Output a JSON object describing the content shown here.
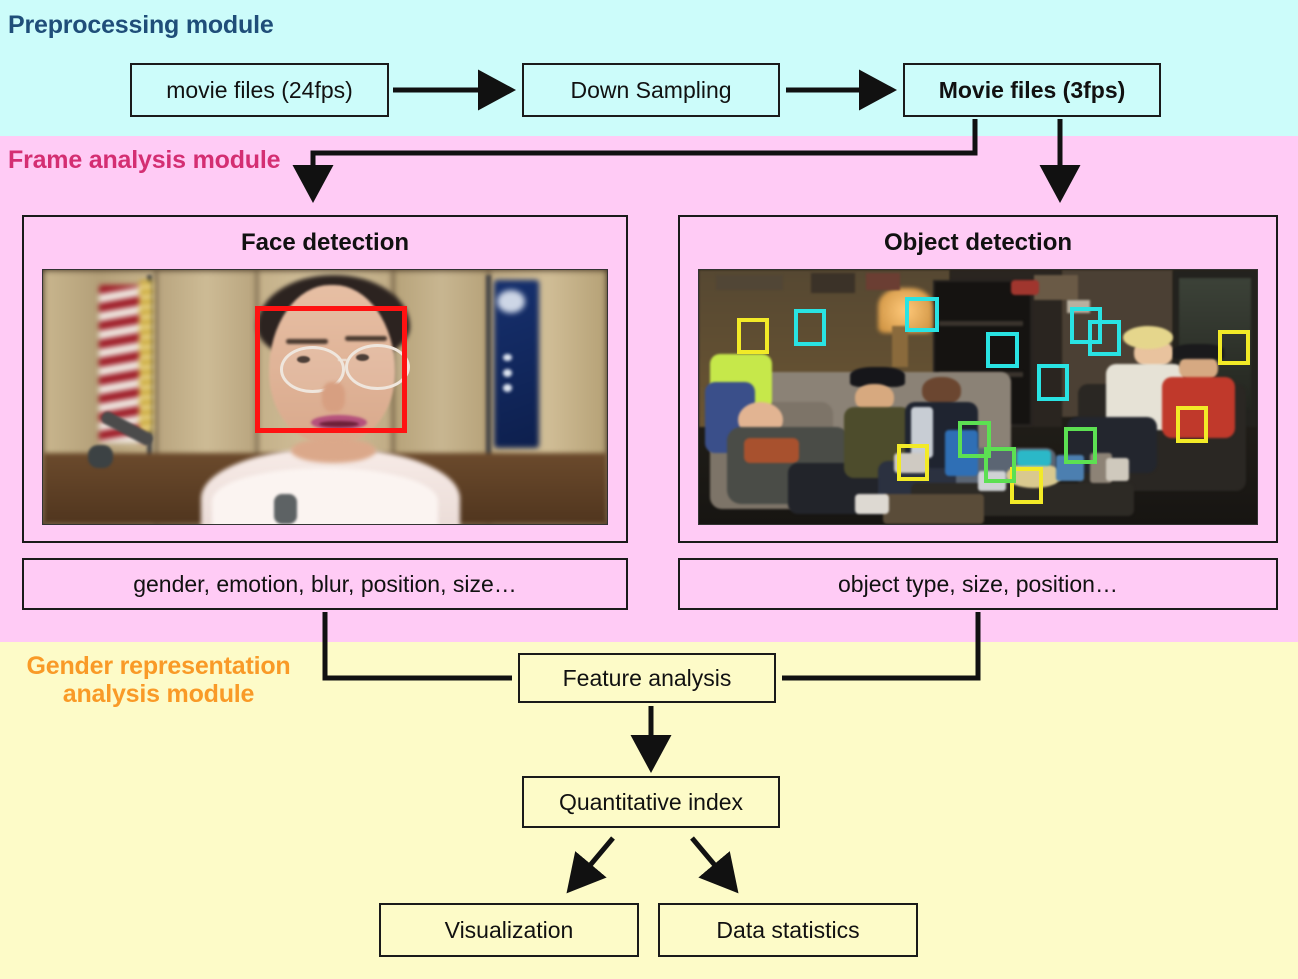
{
  "modules": {
    "preprocessing": {
      "label": "Preprocessing module",
      "color": "#1f4e79"
    },
    "frame_analysis": {
      "label": "Frame analysis module",
      "color": "#d42e72"
    },
    "gender_representation": {
      "label": "Gender representation\nanalysis module",
      "color": "#f99a27"
    }
  },
  "preprocessing_flow": {
    "movie_files_input": "movie files (24fps)",
    "down_sampling": "Down Sampling",
    "movie_files_output": "Movie files (3fps)"
  },
  "frame_analysis": {
    "face_panel": {
      "title": "Face detection",
      "features": "gender, emotion, blur, position, size…",
      "box_color": "#ff1212"
    },
    "object_panel": {
      "title": "Object detection",
      "features": "object type, size, position…",
      "box_colors": [
        "#29e3e3",
        "#f2ea27",
        "#5ce052"
      ]
    }
  },
  "gender_flow": {
    "feature_analysis": "Feature analysis",
    "quantitative_index": "Quantitative index",
    "visualization": "Visualization",
    "data_statistics": "Data statistics"
  },
  "band_colors": {
    "preprocessing": "#ccfcfa",
    "frame_analysis": "#ffcbf5",
    "gender": "#fdfbc8"
  }
}
